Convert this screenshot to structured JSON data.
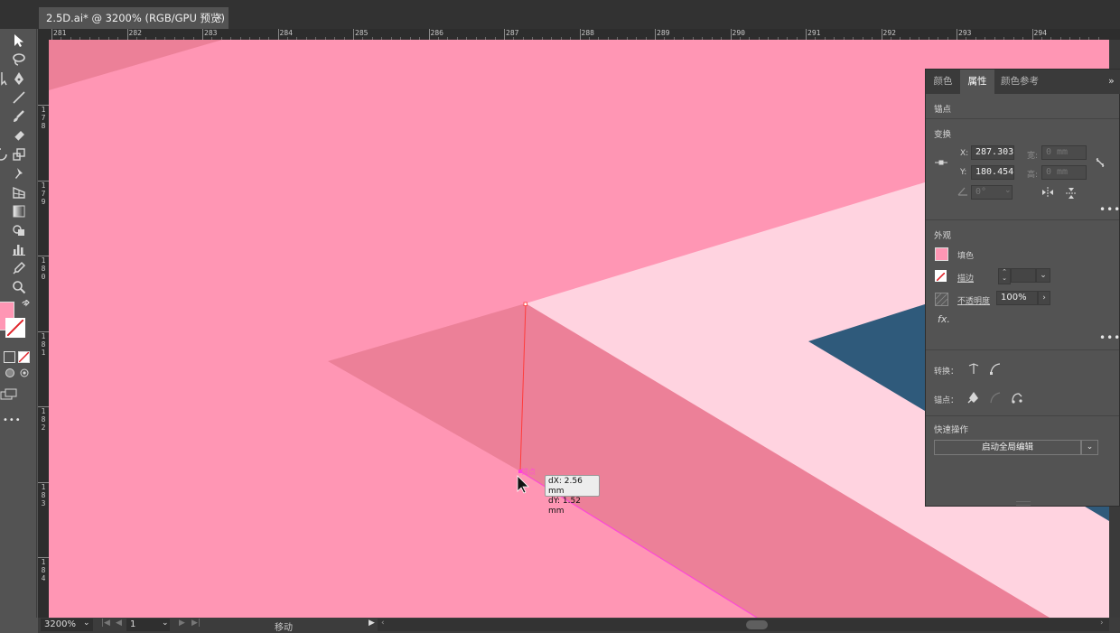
{
  "document": {
    "tab_title": "2.5D.ai* @ 3200% (RGB/GPU 预览)",
    "close_glyph": "×"
  },
  "rulers": {
    "horizontal_labels": [
      "281",
      "282",
      "283",
      "284",
      "285",
      "286",
      "287",
      "288",
      "289",
      "290",
      "291",
      "292",
      "293",
      "294"
    ],
    "vertical_labels": [
      [
        "1",
        "7",
        "8"
      ],
      [
        "1",
        "7",
        "9"
      ],
      [
        "1",
        "8",
        "0"
      ],
      [
        "1",
        "8",
        "1"
      ],
      [
        "1",
        "8",
        "2"
      ],
      [
        "1",
        "8",
        "3"
      ],
      [
        "1",
        "8",
        "4"
      ]
    ]
  },
  "toolbar": {
    "more_glyph": "•••",
    "fill_color": "#ff96b4"
  },
  "canvas": {
    "colors": {
      "background_pink": "#ff96b4",
      "dark_pink": "#ec8098",
      "light_pink": "#ffd3e0",
      "navy": "#2f5a7b",
      "selection_red": "#ff3b3b",
      "path_magenta": "#ff3fe0"
    },
    "anchor_label": "锚点",
    "tooltip": {
      "dx": "dX: 2.56 mm",
      "dy": "dY: 1.52 mm"
    }
  },
  "properties_panel": {
    "tabs": [
      "颜色",
      "属性",
      "颜色参考"
    ],
    "active_tab": "属性",
    "collapse_glyph": "»",
    "object_type": "锚点",
    "transform": {
      "title": "变换",
      "x_label": "X:",
      "x_value": "287.303",
      "y_label": "Y:",
      "y_value": "180.454",
      "w_label": "宽:",
      "w_value": "0 mm",
      "h_label": "高:",
      "h_value": "0 mm",
      "angle_value": "0°"
    },
    "appearance": {
      "title": "外观",
      "fill_label": "填色",
      "fill_color": "#ff96b4",
      "stroke_label": "描边",
      "opacity_label": "不透明度",
      "opacity_value": "100%",
      "fx_label": "fx."
    },
    "convert": {
      "label": "转换："
    },
    "anchor_points": {
      "label": "锚点："
    },
    "quick_actions": {
      "title": "快速操作",
      "button_label": "启动全局编辑"
    },
    "more_glyph": "•••"
  },
  "statusbar": {
    "zoom": "3200%",
    "artboard_number": "1",
    "tool_status": "移动"
  }
}
